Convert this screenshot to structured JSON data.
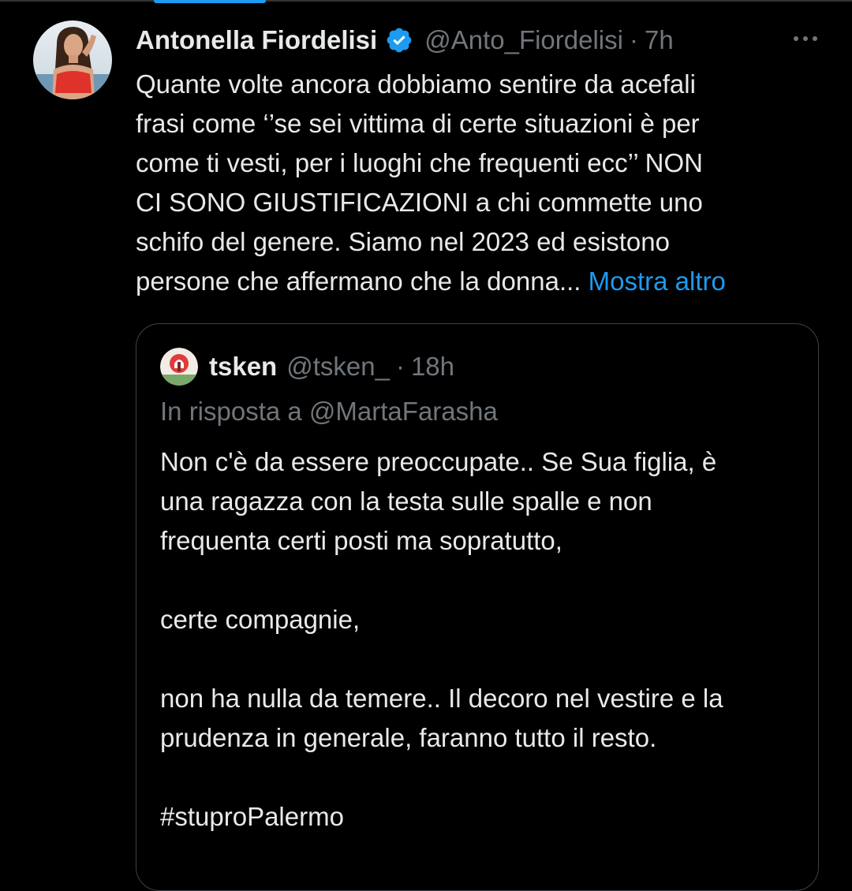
{
  "tweet": {
    "author_name": "Antonella Fiordelisi",
    "verified_icon": "verified-badge-icon",
    "handle": "@Anto_Fiordelisi",
    "separator": "·",
    "time": "7h",
    "more_icon": "more-options-icon",
    "text_lines": [
      "Quante volte ancora dobbiamo sentire da acefali",
      "frasi come ‘’se sei vittima di certe situazioni è per",
      "come ti vesti, per i luoghi che frequenti ecc’’ NON",
      "CI SONO GIUSTIFICAZIONI a chi commette uno",
      "schifo del genere. Siamo nel 2023 ed esistono",
      "persone che affermano che la donna..."
    ],
    "show_more": "Mostra altro"
  },
  "quote": {
    "author_name": "tsken",
    "handle": "@tsken_",
    "separator": "·",
    "time": "18h",
    "reply_to": "In risposta a @MartaFarasha",
    "body_lines": [
      "Non c'è da essere preoccupate.. Se Sua figlia, è",
      "una ragazza con la testa sulle spalle e non",
      "frequenta certi posti ma sopratutto,",
      "",
      "certe compagnie,",
      "",
      "non ha nulla da temere.. Il decoro nel vestire e la",
      "prudenza in generale, faranno tutto il resto.",
      "",
      "#stuproPalermo"
    ]
  },
  "colors": {
    "background": "#000000",
    "text_primary": "#e7e9ea",
    "text_secondary": "#71767b",
    "accent": "#1d9bf0",
    "border": "#3e4144"
  }
}
